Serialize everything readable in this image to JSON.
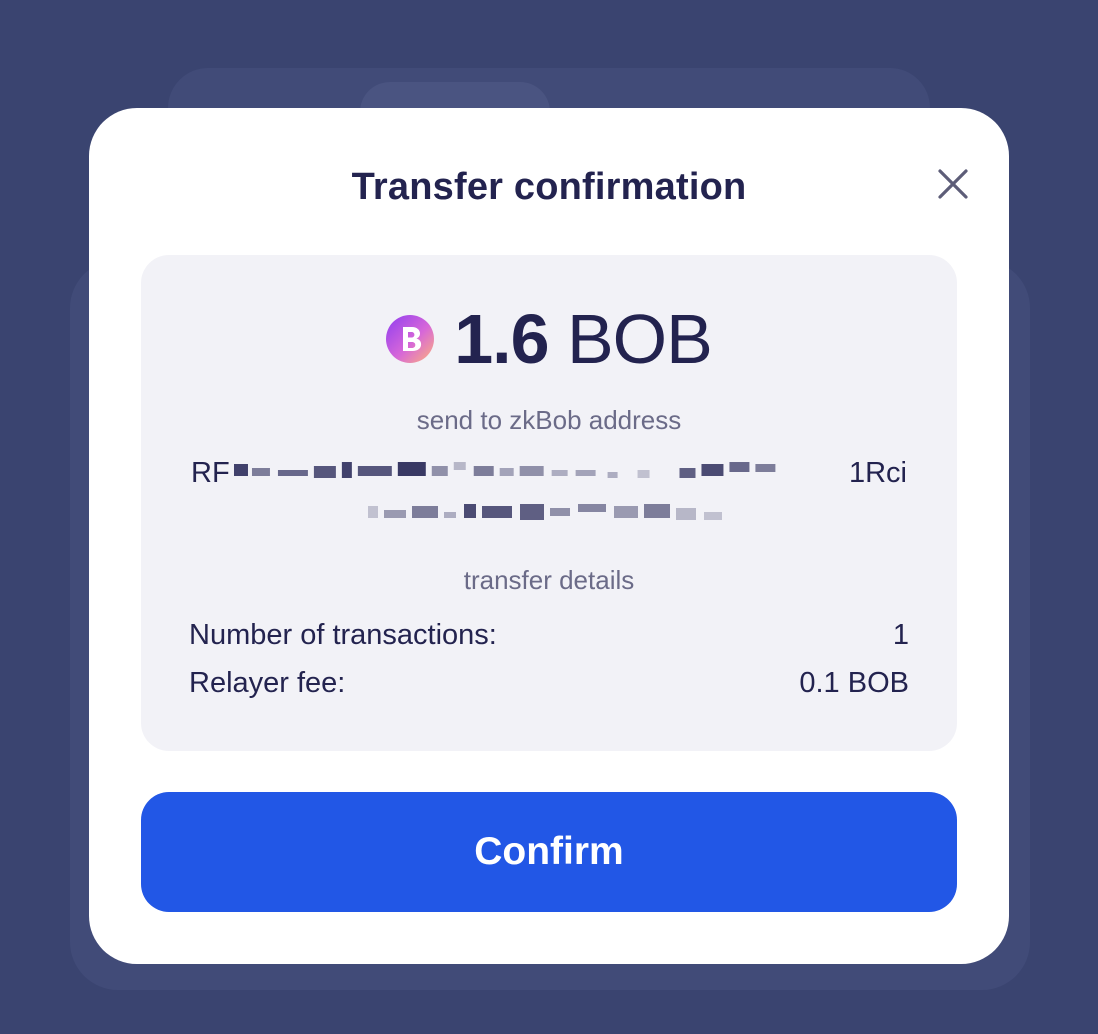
{
  "modal": {
    "title": "Transfer confirmation",
    "amount": {
      "value": "1.6",
      "token": "BOB",
      "icon": "bob-token-icon"
    },
    "send_label": "send to zkBob address",
    "address": {
      "prefix": "RF",
      "suffix": "1Rci"
    },
    "details_label": "transfer details",
    "details": [
      {
        "label": "Number of transactions:",
        "value": "1"
      },
      {
        "label": "Relayer fee:",
        "value": "0.1 BOB"
      }
    ],
    "confirm_label": "Confirm"
  },
  "colors": {
    "accent": "#2257e6",
    "text_primary": "#23234f",
    "text_secondary": "#6b6b88",
    "backdrop": "#3a4470",
    "panel": "#f2f2f7"
  }
}
